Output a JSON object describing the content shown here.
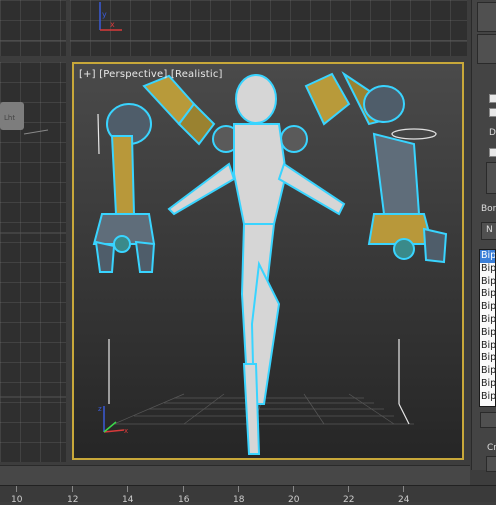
{
  "viewports": {
    "perspective": {
      "menu": "[+]",
      "view": "[Perspective]",
      "shading": "[Realistic]"
    }
  },
  "command_panel": {
    "section_label_1": "D",
    "bones_label": "Bor",
    "name_button": "N",
    "bones": [
      "Bip",
      "Bip",
      "Bip",
      "Bip",
      "Bip",
      "Bip",
      "Bip",
      "Bip",
      "Bip",
      "Bip",
      "Bip",
      "Bip"
    ],
    "create_label": "Cr"
  },
  "timeline": {
    "ticks": [
      "10",
      "12",
      "14",
      "16",
      "18",
      "20",
      "22",
      "24"
    ]
  },
  "colors": {
    "selection_border": "#c8a83a",
    "highlight": "#39d4ff",
    "list_selected": "#3b7fd8"
  }
}
